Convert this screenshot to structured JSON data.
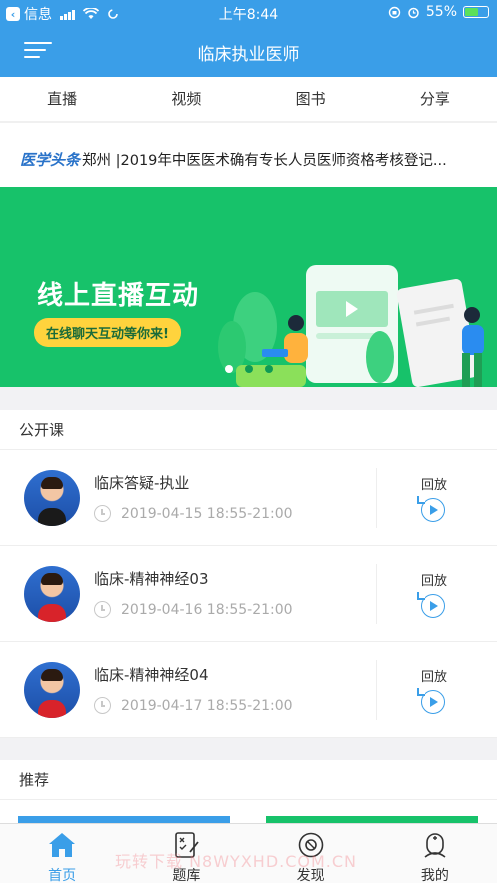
{
  "status_bar": {
    "carrier": "信息",
    "time": "上午8:44",
    "battery": "55%",
    "battery_level": 0.55
  },
  "header": {
    "title": "临床执业医师",
    "menu_icon": "menu-icon"
  },
  "tabs": [
    {
      "label": "直播"
    },
    {
      "label": "视频"
    },
    {
      "label": "图书"
    },
    {
      "label": "分享"
    }
  ],
  "headline": {
    "logo_text": "医学头条",
    "text": "郑州 |2019年中医医术确有专长人员医师资格考核登记..."
  },
  "banner": {
    "title": "线上直播互动",
    "pill": "在线聊天互动等你来!",
    "active_dot": 0,
    "dot_count": 3,
    "bg_color": "#17c26a"
  },
  "public_courses": {
    "header": "公开课",
    "items": [
      {
        "title": "临床答疑-执业",
        "time": "2019-04-15 18:55-21:00",
        "replay_label": "回放",
        "avatar": "avatar-teacher-1"
      },
      {
        "title": "临床-精神神经03",
        "time": "2019-04-16 18:55-21:00",
        "replay_label": "回放",
        "avatar": "avatar-teacher-2"
      },
      {
        "title": "临床-精神神经04",
        "time": "2019-04-17 18:55-21:00",
        "replay_label": "回放",
        "avatar": "avatar-teacher-2"
      }
    ]
  },
  "recommend": {
    "header": "推荐"
  },
  "tabbar": {
    "items": [
      {
        "label": "首页",
        "icon": "home-icon",
        "active": true
      },
      {
        "label": "题库",
        "icon": "question-bank-icon",
        "active": false
      },
      {
        "label": "发现",
        "icon": "discover-icon",
        "active": false
      },
      {
        "label": "我的",
        "icon": "profile-icon",
        "active": false
      }
    ]
  },
  "watermark": "玩转下载 N8WYXHD.COM.CN",
  "colors": {
    "accent": "#3a9ee8",
    "banner_green": "#17c26a",
    "pill_yellow": "#ffd33d"
  }
}
